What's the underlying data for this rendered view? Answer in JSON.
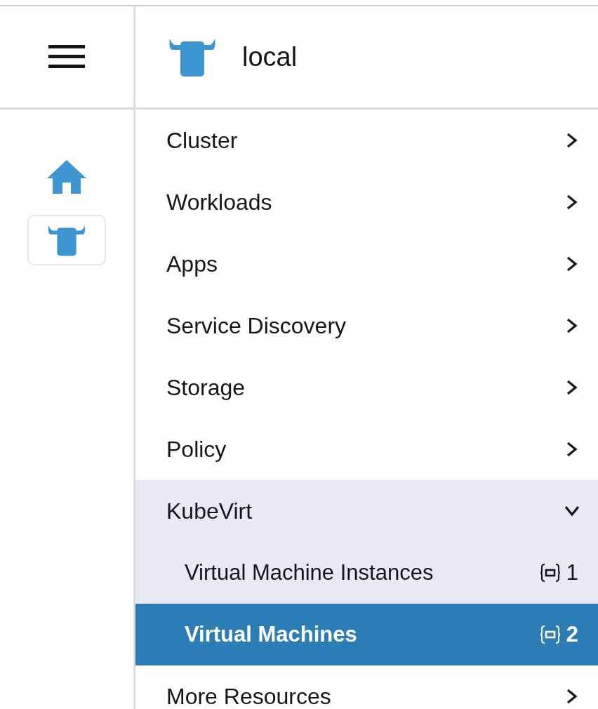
{
  "header": {
    "cluster_name": "local"
  },
  "rail": [
    {
      "kind": "home",
      "selected": false
    },
    {
      "kind": "cluster",
      "selected": true
    }
  ],
  "menu": [
    {
      "label": "Cluster",
      "expanded": false
    },
    {
      "label": "Workloads",
      "expanded": false
    },
    {
      "label": "Apps",
      "expanded": false
    },
    {
      "label": "Service Discovery",
      "expanded": false
    },
    {
      "label": "Storage",
      "expanded": false
    },
    {
      "label": "Policy",
      "expanded": false
    },
    {
      "label": "KubeVirt",
      "expanded": true,
      "children": [
        {
          "label": "Virtual Machine Instances",
          "count": "1",
          "selected": false
        },
        {
          "label": "Virtual Machines",
          "count": "2",
          "selected": true
        }
      ]
    },
    {
      "label": "More Resources",
      "expanded": false
    }
  ]
}
